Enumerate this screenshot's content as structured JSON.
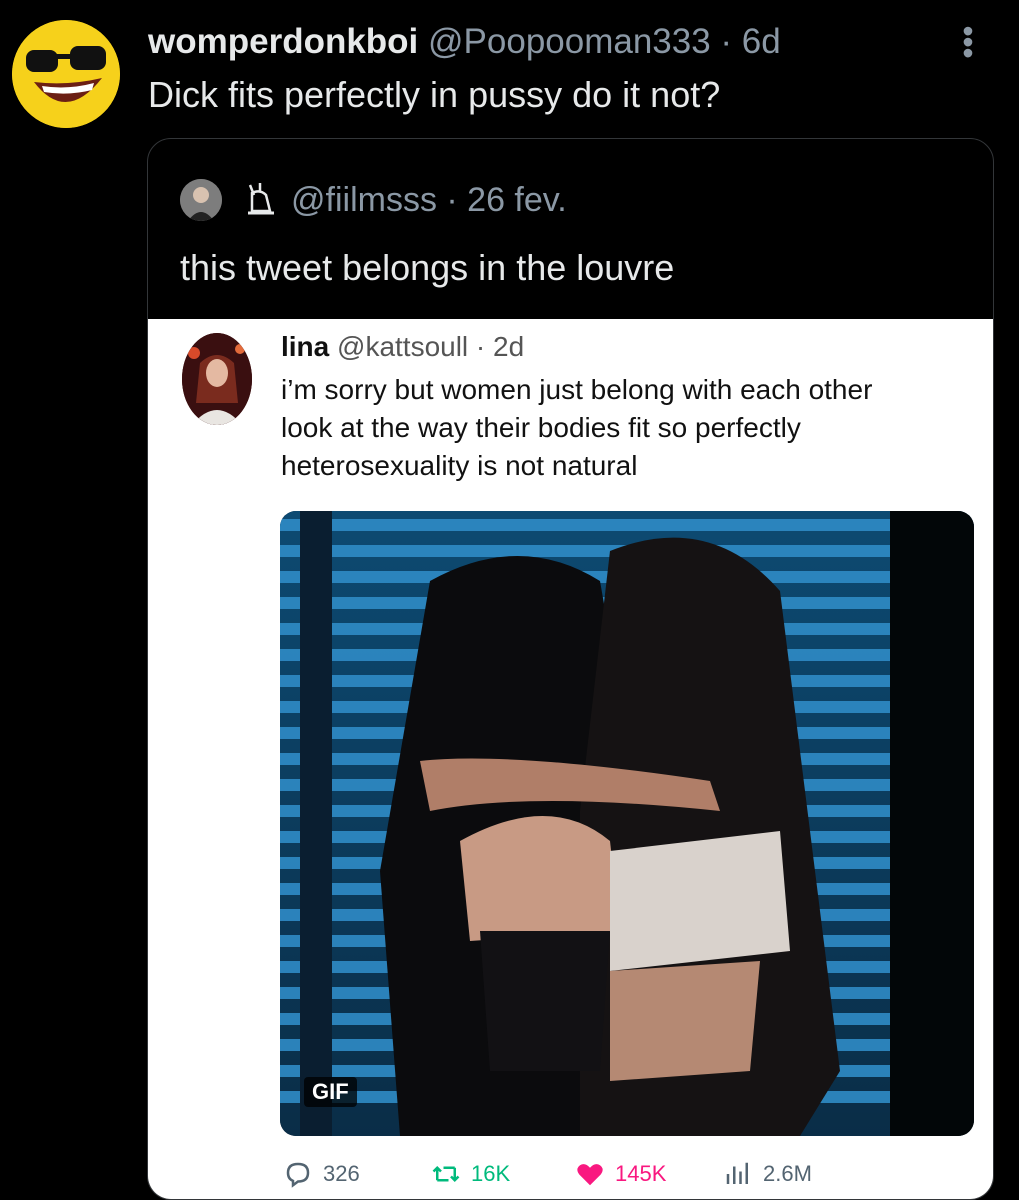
{
  "tweet": {
    "display_name": "womperdonkboi",
    "handle_meta": "@Poopooman333 · 6d",
    "text": "Dick fits perfectly in pussy do it not?"
  },
  "quote": {
    "handle_meta": "@fiilmsss · 26 fev.",
    "text": "this tweet belongs in the louvre"
  },
  "embedded": {
    "name": "lina",
    "handle_meta": "@kattsoull · 2d",
    "lines": [
      "i’m sorry but women just belong with each other",
      "look at the way their bodies fit so perfectly",
      "heterosexuality is not natural"
    ],
    "media_badge": "GIF",
    "stats": {
      "replies": "326",
      "reposts": "16K",
      "likes": "145K",
      "views": "2.6M"
    }
  },
  "colors": {
    "background": "#000000",
    "muted": "#8b98a5",
    "repost": "#00ba7c",
    "like": "#f91880"
  },
  "icons": [
    "more-icon",
    "bust-badge-icon",
    "reply-icon",
    "repost-icon",
    "like-icon",
    "views-icon"
  ]
}
